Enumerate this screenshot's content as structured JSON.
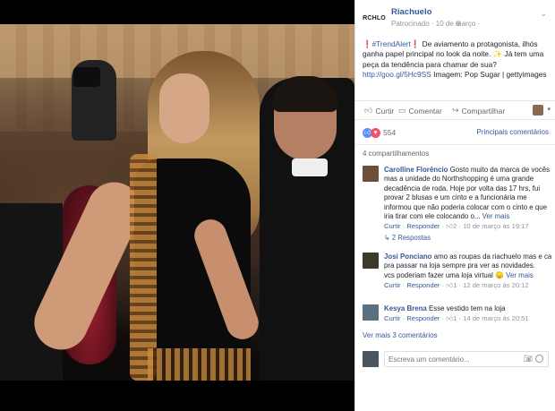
{
  "post": {
    "page_name": "Riachuelo",
    "logo_text": "RCHLO",
    "time": "Patrocinado · 10 de março ·",
    "globe_icon": "globe-icon",
    "caption_alert1": "❗",
    "caption_tag": "#TrendAlert",
    "caption_alert2": "❗",
    "caption_text1": " De aviamento a protagonista, ilhós ganha papel principal no look da noite.",
    "caption_spark": "✨",
    "caption_text2": " Já tem uma peça da tendência para chamar de sua?",
    "caption_link": "http://goo.gl/5Hc9SS",
    "caption_text3": " Imagem: Pop Sugar | gettyimages"
  },
  "actions": {
    "like": "Curtir",
    "comment": "Comentar",
    "share": "Compartilhar"
  },
  "reactions": {
    "count": "554",
    "order": "Principais comentários"
  },
  "shares_text": "4 compartilhamentos",
  "comments": [
    {
      "name": "Carolline Florêncio",
      "text": " Gosto muito da marca de vocês mas a unidade do Northshopping é uma grande decadência de roda. Hoje por volta das 17 hrs, fui provar 2 blusas e um cinto e a funcionária me informou que não poderia colocar com o cinto e que iria tirar com ele colocando o...",
      "more": " Ver mais",
      "meta_like": "Curtir",
      "meta_reply": "Responder",
      "meta_likes": "2",
      "meta_time": "10 de março às 19:17",
      "replies": "↳ 2 Respostas",
      "avatar_color": "#6e4e3a"
    },
    {
      "name": "Josi Ponciano",
      "text": " amo as roupas da riachuelo mas e ca pra passar na loja sempre pra ver as novidades.",
      "text2": "vcs poderiam fazer uma loja virtual",
      "emoji": "😞",
      "more": " Ver mais",
      "meta_like": "Curtir",
      "meta_reply": "Responder",
      "meta_likes": "1",
      "meta_time": "12 de março às 20:12",
      "avatar_color": "#3d3a2a"
    },
    {
      "name": "Kesya Brena",
      "text": " Esse vestido tem na loja",
      "meta_like": "Curtir",
      "meta_reply": "Responder",
      "meta_likes": "1",
      "meta_time": "14 de março às 20:51",
      "avatar_color": "#5a7080"
    }
  ],
  "more_comments": "Ver mais 3 comentários",
  "write": {
    "placeholder": "Escreva um comentário..."
  },
  "colors": {
    "link": "#365899",
    "meta": "#90949c",
    "like": "#5890ff",
    "love": "#f25268"
  }
}
